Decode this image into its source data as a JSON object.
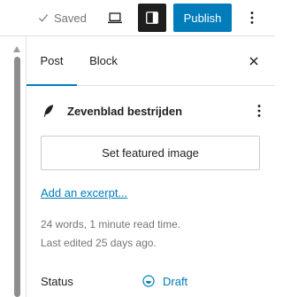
{
  "topbar": {
    "saved_label": "Saved",
    "publish_label": "Publish"
  },
  "sidebar": {
    "tabs": [
      {
        "label": "Post"
      },
      {
        "label": "Block"
      }
    ],
    "post_title": "Zevenblad bestrijden",
    "featured_image_label": "Set featured image",
    "excerpt_link": "Add an excerpt...",
    "stats_line": "24 words, 1 minute read time.",
    "last_edited": "Last edited 25 days ago.",
    "status_label": "Status",
    "status_value": "Draft"
  },
  "icons": {
    "saved": "check-icon",
    "preview": "laptop-icon",
    "settings": "sidebar-toggle-icon",
    "more": "more-vertical-icon",
    "close": "close-icon",
    "post": "feather-icon",
    "status": "draft-circle-icon"
  },
  "colors": {
    "accent": "#007cba",
    "text": "#1e1e1e",
    "muted": "#757575",
    "border": "#e0e0e0",
    "settings_active_bg": "#1e1e1e"
  }
}
